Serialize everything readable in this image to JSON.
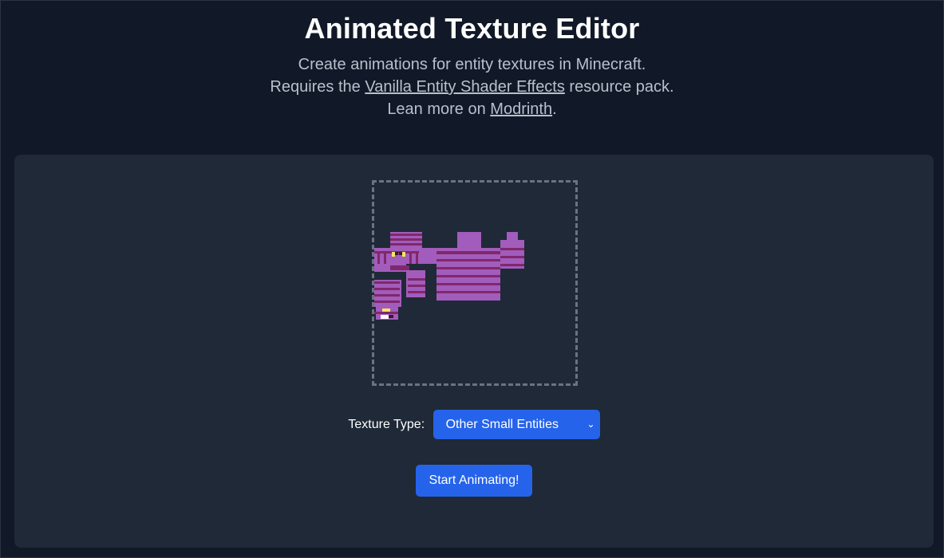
{
  "header": {
    "title": "Animated Texture Editor",
    "line1": "Create animations for entity textures in Minecraft.",
    "line2_prefix": "Requires the ",
    "line2_link": "Vanilla Entity Shader Effects",
    "line2_suffix": " resource pack.",
    "line3_prefix": "Lean more on ",
    "line3_link": "Modrinth",
    "line3_suffix": "."
  },
  "editor": {
    "preview_icon": "entity-texture-preview",
    "texture_type_label": "Texture Type:",
    "texture_type_value": "Other Small Entities",
    "start_button_label": "Start Animating!"
  },
  "colors": {
    "accent": "#2563eb",
    "texture_light": "#a25cbc",
    "texture_dark": "#80286b"
  }
}
